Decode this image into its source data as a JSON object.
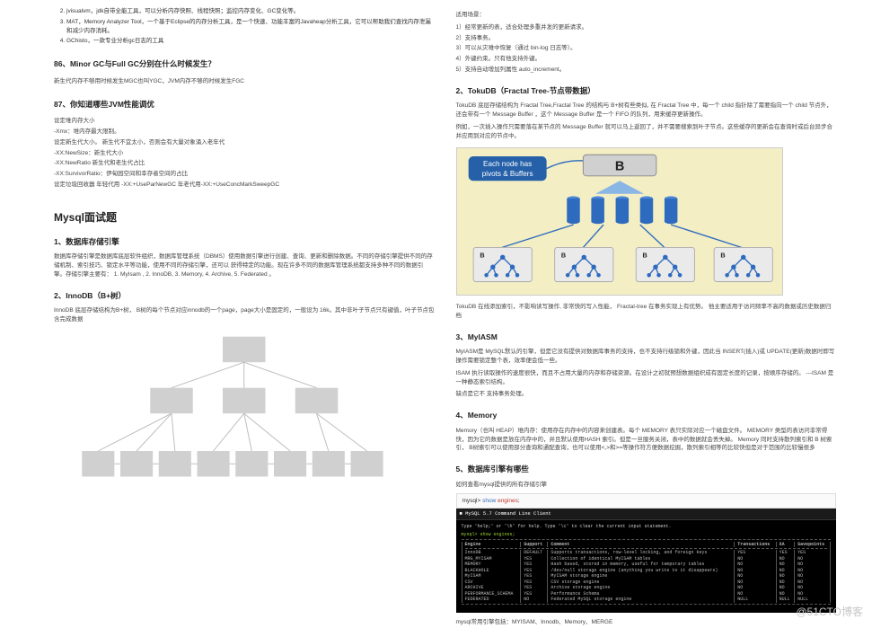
{
  "watermark": "@51CTO博客",
  "left": {
    "ol": [
      "jvisualvm，jdk自带全能工具，可以分析内存快照、线程快照；监控内存变化、GC变化等。",
      "MAT，Memory Analyzer Tool，一个基于Eclipse的内存分析工具，是一个快速、功能丰富的Javaheap分析工具，它可以帮助我们查找内存泄漏和减少内存消耗。",
      "GChisto，一款专业分析gc日志的工具"
    ],
    "q86": "86、Minor GC与Full GC分别在什么时候发生？",
    "a86": "新生代内存不够用时候发生MGC也叫YGC，JVM内存不够的时候发生FGC",
    "q87": "87、你知道哪些JVM性能调优",
    "a87": [
      "设定堆内存大小",
      "-Xmx：堆内存最大限制。",
      "设定新生代大小。 新生代不宜太小，否则会有大量对象涌入老年代",
      "-XX:NewSize：新生代大小",
      "-XX:NewRatio 新生代和老生代占比",
      "-XX:SurvivorRatio：伊甸园空间和幸存者空间的占比",
      "设定垃圾回收器 年轻代用 -XX:+UseParNewGC 年老代用-XX:+UseConcMarkSweepGC"
    ],
    "mysqlTitle": "Mysql面试题",
    "s1": "1、数据库存储引擎",
    "s1p": "数据库存储引擎是数据库底层软件组织，数据库管理系统（DBMS）使用数据引擎进行创建、查询、更新和删除数据。不同的存储引擎提供不同的存储机制、索引技巧、锁定水平等功能，使用不同的存储引擎，还可以 获得特定的功能。现在许多不同的数据库管理系统都支持多种不同的数据引擎。存储引擎主要有： 1. MyIsam , 2. InnoDB, 3. Memory, 4. Archive, 5. Federated 。",
    "s2": "2、InnoDB（B+树）",
    "s2p": "InnoDB 底层存储结构为B+树， B树的每个节点对应innodb的一个page，page大小是固定的，一般设为 16k。其中非叶子节点只有键值，叶子节点包含完成数据"
  },
  "right": {
    "scenarios_h": "适用场景：",
    "scenarios": [
      "1）经常更新的表，适合处理多重并发的更新请求。",
      "2）支持事务。",
      "3）可以从灾难中恢复（通过 bin-log 日志等）。",
      "4）外键约束。只有他支持外键。",
      "5）支持自动增加列属性 auto_increment。"
    ],
    "s2t": "2、TokuDB（Fractal Tree-节点带数据）",
    "s2t_p1": "TokuDB 底层存储结构为 Fractal Tree,Fractal Tree 的结构与 B+树有些类似, 在 Fractal Tree 中，每一个 child 指针除了需要指向一个 child 节点外，还会带有一个 Message Buffer ，这个 Message Buffer 是一个 FIFO 的队列，用来缓存更新操作。",
    "s2t_p2": "例如，一次插入操作只需要落在某节点的 Message Buffer 就可以马上返回了，并不需要搜索到叶子节点。这些缓存的更新会在查询时或后台异步合并应用到对应的节点中。",
    "bubble1": "Each node has",
    "bubble2": "pivots & Buffers",
    "s2t_after": "TokuDB 在线添加索引，不影响读写操作, 非常快的写入性能， Fractal-tree 在事务实现上有优势。 他主要适用于访问频率不高的数据或历史数据归档",
    "s3": "3、MyIASM",
    "s3p1": "MyIASM是 MySQL默认的引擎，但是它没有提供对数据库事务的支持，也不支持行级锁和外键，因此当 INSERT(插入)或 UPDATE(更新)数据时即写操作需要锁定整个表，效率便会低一些。",
    "s3p2": "ISAM 执行读取操作的速度很快，而且不占用大量的内存和存储资源。在设计之初就预想数据组织成有固定长度的记录，按顺序存储的。 ---ISAM 是一种静态索引结构。",
    "s3p3": "缺点是它不 支持事务处理。",
    "s4": "4、Memory",
    "s4p": "Memory（也叫 HEAP）堆内存：使用存在内存中的内容来创建表。每个 MEMORY 表只实际对应一个磁盘文件。 MEMORY 类型的表访问非常得快，因为它的数据是放在内存中的，并且默认使用HASH 索引。但是一旦服务关闭，表中的数据就会丢失掉。 Memory 同时支持散列索引和 B 树索引， B树索引可以使用部分查询和通配查询，也可以使用<,>和>=等操作符方便数据挖掘，散列索引相等的比较快但是对于范围的比较慢很多",
    "s5": "5、数据库引擎有哪些",
    "s5p": "如何查看mysql提供的所有存储引擎",
    "code_prompt": "mysql>",
    "code_cmd": "show engines;",
    "term_title": "MySQL 5.7 Command Line Client",
    "term_l1": "Type 'help;' or '\\h' for help. Type '\\c' to clear the current input statement.",
    "term_l2": "mysql> show engines;",
    "cols": [
      "Engine",
      "Support",
      "Comment",
      "Transactions",
      "XA",
      "Savepoints"
    ],
    "rows": [
      [
        "InnoDB",
        "DEFAULT",
        "Supports transactions, row-level locking, and foreign keys",
        "YES",
        "YES",
        "YES"
      ],
      [
        "MRG_MYISAM",
        "YES",
        "Collection of identical MyISAM tables",
        "NO",
        "NO",
        "NO"
      ],
      [
        "MEMORY",
        "YES",
        "Hash based, stored in memory, useful for temporary tables",
        "NO",
        "NO",
        "NO"
      ],
      [
        "BLACKHOLE",
        "YES",
        "/dev/null storage engine (anything you write to it disappears)",
        "NO",
        "NO",
        "NO"
      ],
      [
        "MyISAM",
        "YES",
        "MyISAM storage engine",
        "NO",
        "NO",
        "NO"
      ],
      [
        "CSV",
        "YES",
        "CSV storage engine",
        "NO",
        "NO",
        "NO"
      ],
      [
        "ARCHIVE",
        "YES",
        "Archive storage engine",
        "NO",
        "NO",
        "NO"
      ],
      [
        "PERFORMANCE_SCHEMA",
        "YES",
        "Performance Schema",
        "NO",
        "NO",
        "NO"
      ],
      [
        "FEDERATED",
        "NO",
        "Federated MySQL storage engine",
        "NULL",
        "NULL",
        "NULL"
      ]
    ],
    "s5after": "mysql常用引擎包括：MYISAM、Innodb、Memory、MERGE"
  }
}
